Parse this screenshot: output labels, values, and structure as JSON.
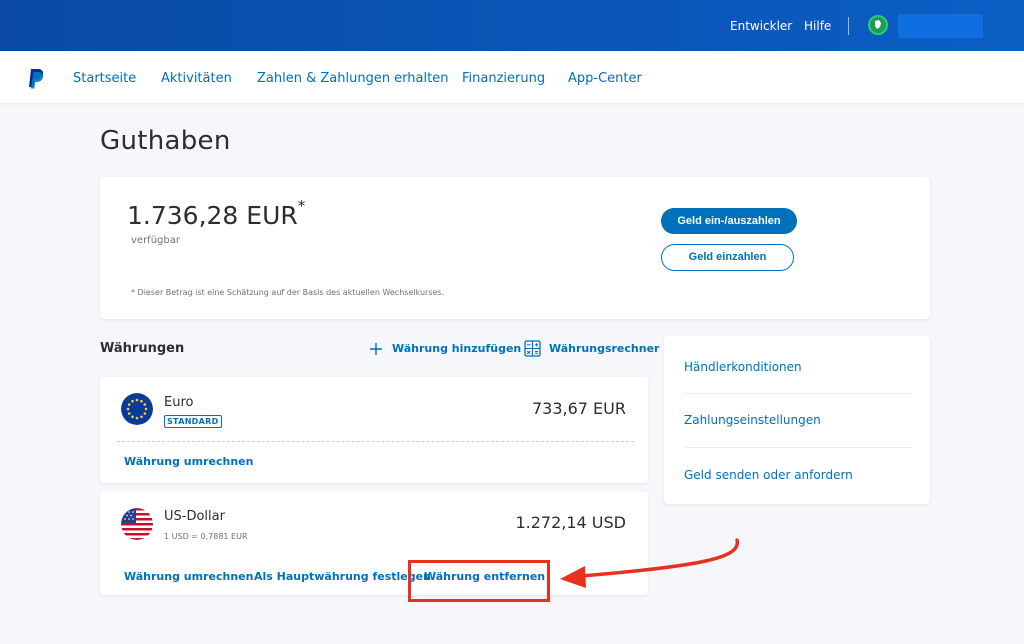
{
  "topbar": {
    "developer": "Entwickler",
    "help": "Hilfe"
  },
  "nav": {
    "items": [
      "Startseite",
      "Aktivitäten",
      "Zahlen & Zahlungen erhalten",
      "Finanzierung",
      "App-Center"
    ]
  },
  "page": {
    "title": "Guthaben"
  },
  "balance": {
    "amount": "1.736,28 EUR",
    "asterisk": "*",
    "available": "verfügbar",
    "note": "* Dieser Betrag ist eine Schätzung auf der Basis des aktuellen Wechselkurses.",
    "withdraw_button": "Geld ein-/auszahlen",
    "deposit_button": "Geld einzahlen"
  },
  "currencies": {
    "heading": "Währungen",
    "add_label": "Währung hinzufügen",
    "converter_label": "Währungsrechner",
    "items": [
      {
        "name": "Euro",
        "badge": "STANDARD",
        "amount": "733,67 EUR",
        "actions": [
          "Währung umrechnen"
        ]
      },
      {
        "name": "US-Dollar",
        "rate": "1 USD = 0,7881 EUR",
        "amount": "1.272,14 USD",
        "actions": [
          "Währung umrechnen",
          "Als Hauptwährung festlegen",
          "Währung entfernen"
        ]
      }
    ]
  },
  "sidebar": {
    "items": [
      "Händlerkonditionen",
      "Zahlungseinstellungen",
      "Geld senden oder anfordern"
    ]
  },
  "colors": {
    "accent": "#0070ba",
    "topbar": "#0a56b8",
    "highlight": "#e8301f"
  }
}
